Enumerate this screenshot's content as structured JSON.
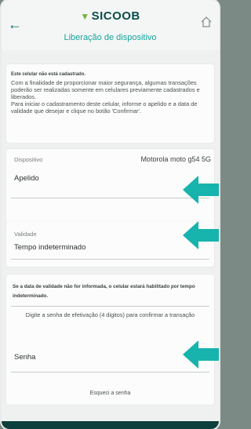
{
  "header": {
    "logo_text": "SICOOB",
    "title": "Liberação de dispositivo"
  },
  "info": {
    "heading": "Este celular não está cadastrado.",
    "paragraph1": "Com a finalidade de proporcionar maior segurança, algumas transações poderão ser realizadas somente em celulares previamente cadastrados e liberados.",
    "paragraph2": "Para iniciar o cadastramento deste celular, informe o apelido e a data de validade que desejar e clique no botão 'Confirmar'."
  },
  "device": {
    "label": "Dispositivo",
    "value": "Motorola moto g54 5G",
    "nickname_placeholder": "Apelido"
  },
  "validity": {
    "label": "Validade",
    "value": "Tempo indeterminado"
  },
  "notice": {
    "warning": "Se a data de validade não for informada, o celular estará habilitado por tempo indeterminado.",
    "instruction": "Digite a senha de efetivação (4 digitos) para confirmar a transação",
    "password_placeholder": "Senha",
    "forgot_link": "Esqueci a senha"
  },
  "colors": {
    "accent": "#15a59c",
    "arrow": "#17b3ad",
    "brand_dark": "#0b4f4a"
  },
  "icons": [
    "back-arrow-icon",
    "home-icon",
    "sicoob-logo-icon",
    "pointer-arrow-icon"
  ]
}
